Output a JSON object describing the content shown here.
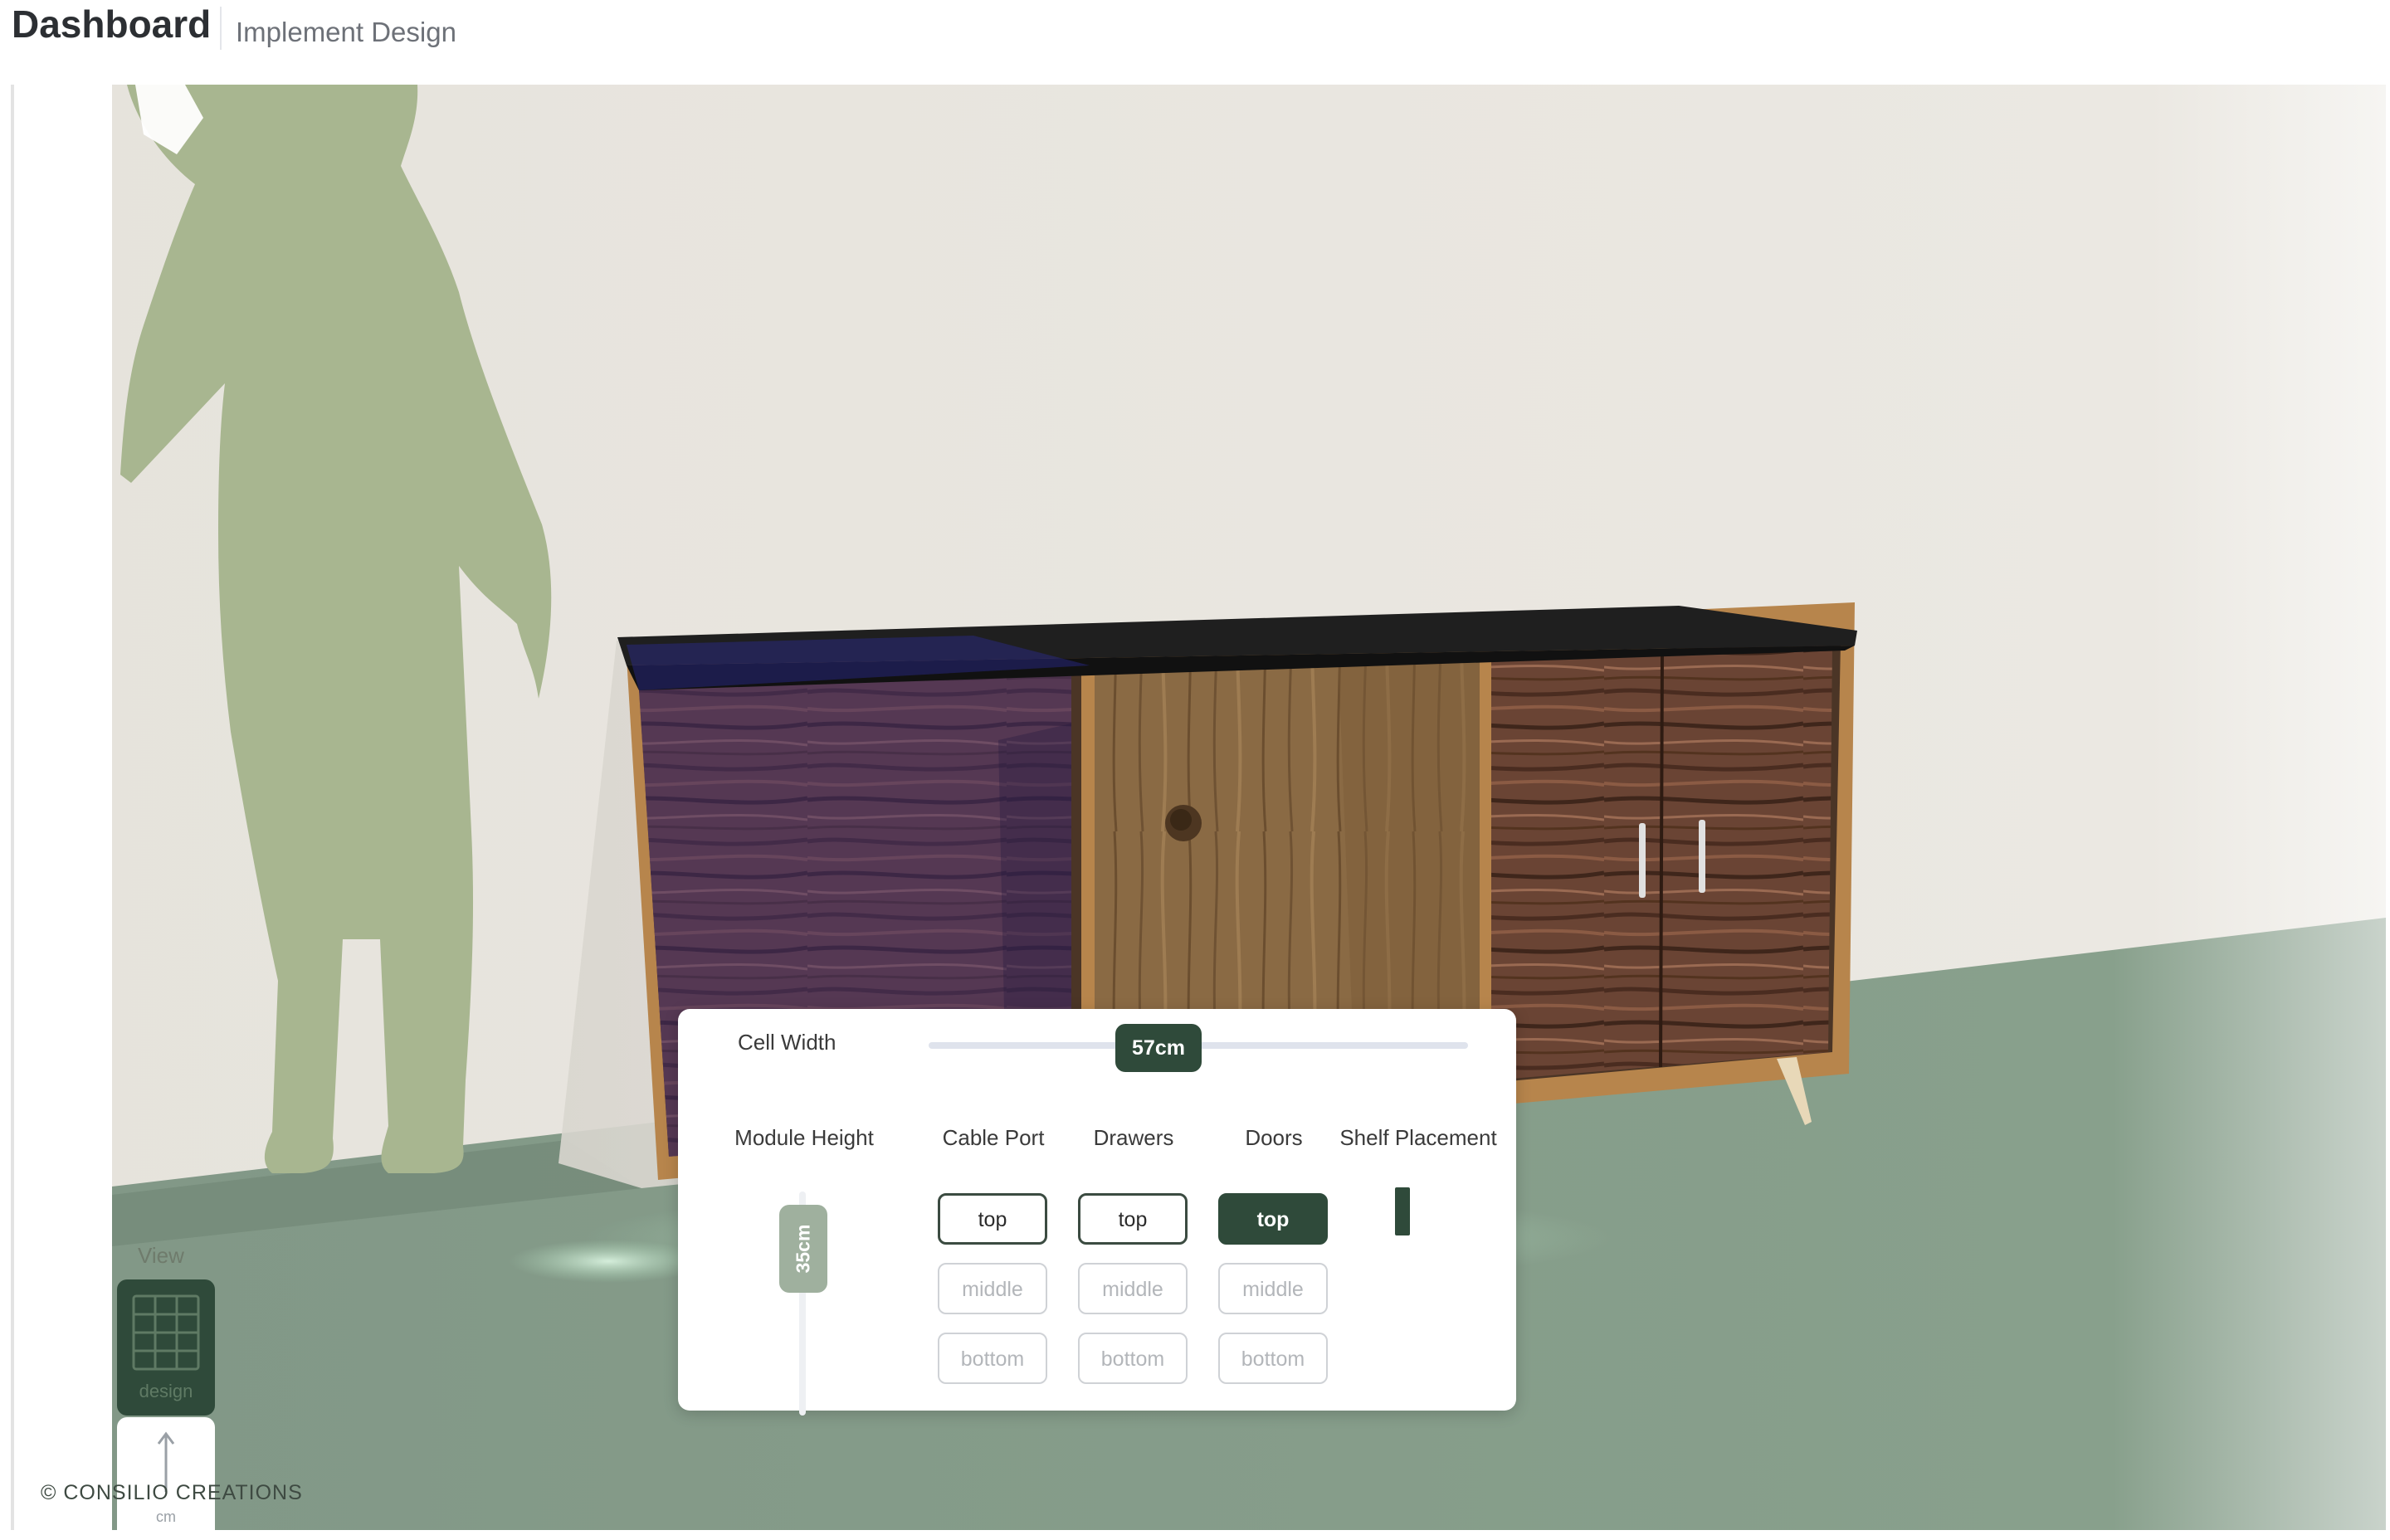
{
  "header": {
    "title": "Dashboard",
    "subtitle": "Implement Design"
  },
  "panel": {
    "cell_width": {
      "label": "Cell Width",
      "value": "57cm"
    },
    "module_height": {
      "label": "Module Height",
      "value": "35cm"
    },
    "columns": [
      {
        "label": "Cable Port",
        "options": [
          "top",
          "middle",
          "bottom"
        ],
        "selected": "top",
        "state": "outlined"
      },
      {
        "label": "Drawers",
        "options": [
          "top",
          "middle",
          "bottom"
        ],
        "selected": "top",
        "state": "outlined"
      },
      {
        "label": "Doors",
        "options": [
          "top",
          "middle",
          "bottom"
        ],
        "selected": "top",
        "state": "filled"
      }
    ],
    "shelf_placement": {
      "label": "Shelf Placement"
    }
  },
  "view": {
    "label": "View",
    "design_label": "design",
    "cm_label": "cm"
  },
  "footer": {
    "copyright": "© CONSILIO CREATIONS"
  },
  "colors": {
    "accent": "#2f4a3a",
    "wall": "#e9e6df",
    "floor": "#879c8a",
    "silhouette": "#a8b690",
    "walnut": "#6a4434",
    "oak": "#8a6a44",
    "selection_tint": "#3c2b7a"
  }
}
